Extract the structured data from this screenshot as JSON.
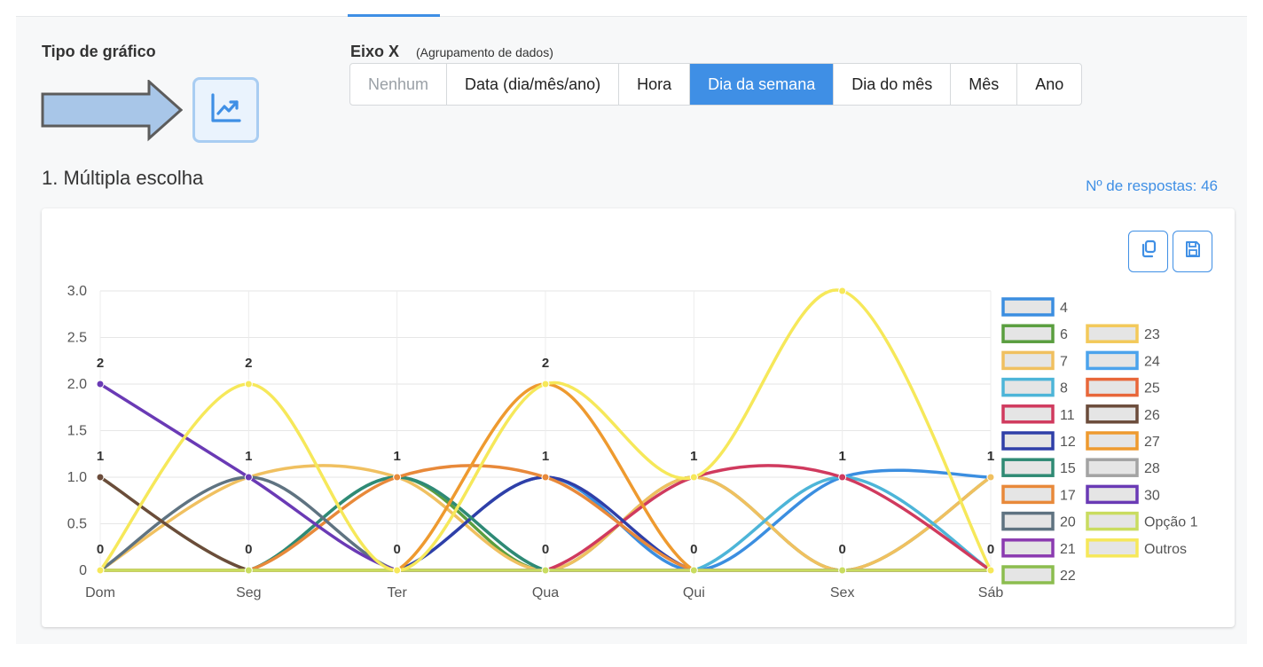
{
  "header": {
    "chart_type_label": "Tipo de gráfico",
    "axis_title": "Eixo X",
    "axis_subtitle": "(Agrupamento de dados)",
    "grouping_options": [
      "Nenhum",
      "Data (dia/mês/ano)",
      "Hora",
      "Dia da semana",
      "Dia do mês",
      "Mês",
      "Ano"
    ],
    "selected_option": "Dia da semana",
    "disabled_option": "Nenhum"
  },
  "question": {
    "title": "1. Múltipla escolha",
    "responses_label": "Nº de respostas: 46"
  },
  "icons": {
    "chart_type": "line-chart-icon",
    "pointer": "arrow-right-icon",
    "copy": "copy-icon",
    "save": "save-icon"
  },
  "colors": {
    "accent": "#3f8fe5"
  },
  "chart_data": {
    "type": "line",
    "smooth": true,
    "categories": [
      "Dom",
      "Seg",
      "Ter",
      "Qua",
      "Qui",
      "Sex",
      "Sáb"
    ],
    "ylim": [
      0,
      3
    ],
    "yticks": [
      "0",
      "0.5",
      "1.0",
      "1.5",
      "2.0",
      "2.5",
      "3.0"
    ],
    "grid": true,
    "legend_position": "right",
    "top_labels": [
      "2",
      "2",
      "1",
      "2",
      "1",
      "1",
      "1"
    ],
    "mid_labels": [
      "1",
      "1",
      "1",
      "1",
      "1",
      "1",
      "1"
    ],
    "zero_labels": [
      "0",
      "0",
      "0",
      "0",
      "0",
      "0",
      "0"
    ],
    "series": [
      {
        "name": "4",
        "color": "#3b8ee0",
        "values": [
          0,
          0,
          0,
          1,
          0,
          1,
          1
        ]
      },
      {
        "name": "6",
        "color": "#5a9e3f",
        "values": [
          0,
          0,
          1,
          0,
          1,
          0,
          1
        ]
      },
      {
        "name": "7",
        "color": "#f0c060",
        "values": [
          0,
          1,
          1,
          0,
          1,
          0,
          1
        ]
      },
      {
        "name": "8",
        "color": "#4db5d8",
        "values": [
          0,
          0,
          1,
          0,
          0,
          1,
          0
        ]
      },
      {
        "name": "11",
        "color": "#d03a5e",
        "values": [
          0,
          0,
          0,
          0,
          1,
          1,
          0
        ]
      },
      {
        "name": "12",
        "color": "#2f3fa8",
        "values": [
          0,
          0,
          0,
          1,
          0,
          0,
          0
        ]
      },
      {
        "name": "15",
        "color": "#2f8a74",
        "values": [
          0,
          0,
          1,
          0,
          0,
          0,
          0
        ]
      },
      {
        "name": "17",
        "color": "#e8893a",
        "values": [
          0,
          0,
          1,
          1,
          0,
          0,
          0
        ]
      },
      {
        "name": "20",
        "color": "#5f7381",
        "values": [
          0,
          1,
          0,
          0,
          0,
          0,
          0
        ]
      },
      {
        "name": "21",
        "color": "#8b3bb0",
        "values": [
          0,
          0,
          0,
          0,
          0,
          0,
          0
        ]
      },
      {
        "name": "22",
        "color": "#8cbd4f",
        "values": [
          1,
          0,
          0,
          0,
          0,
          0,
          0
        ]
      },
      {
        "name": "23",
        "color": "#f3c95a",
        "values": [
          0,
          0,
          0,
          0,
          0,
          0,
          0
        ]
      },
      {
        "name": "24",
        "color": "#4ca3ec",
        "values": [
          0,
          0,
          0,
          0,
          0,
          0,
          0
        ]
      },
      {
        "name": "25",
        "color": "#e8673a",
        "values": [
          0,
          0,
          0,
          0,
          0,
          0,
          0
        ]
      },
      {
        "name": "26",
        "color": "#6b4c3b",
        "values": [
          1,
          0,
          0,
          0,
          0,
          0,
          0
        ]
      },
      {
        "name": "27",
        "color": "#ee9a2f",
        "values": [
          0,
          0,
          0,
          2,
          0,
          0,
          0
        ]
      },
      {
        "name": "28",
        "color": "#a3a3a3",
        "values": [
          0,
          0,
          0,
          0,
          0,
          0,
          0
        ]
      },
      {
        "name": "30",
        "color": "#6a3ab5",
        "values": [
          2,
          1,
          0,
          0,
          0,
          0,
          0
        ]
      },
      {
        "name": "Opção 1",
        "color": "#c9dc60",
        "values": [
          0,
          0,
          0,
          0,
          0,
          0,
          0
        ]
      },
      {
        "name": "Outros",
        "color": "#f6e85a",
        "values": [
          0,
          2,
          0,
          2,
          1,
          3,
          0
        ]
      }
    ]
  }
}
